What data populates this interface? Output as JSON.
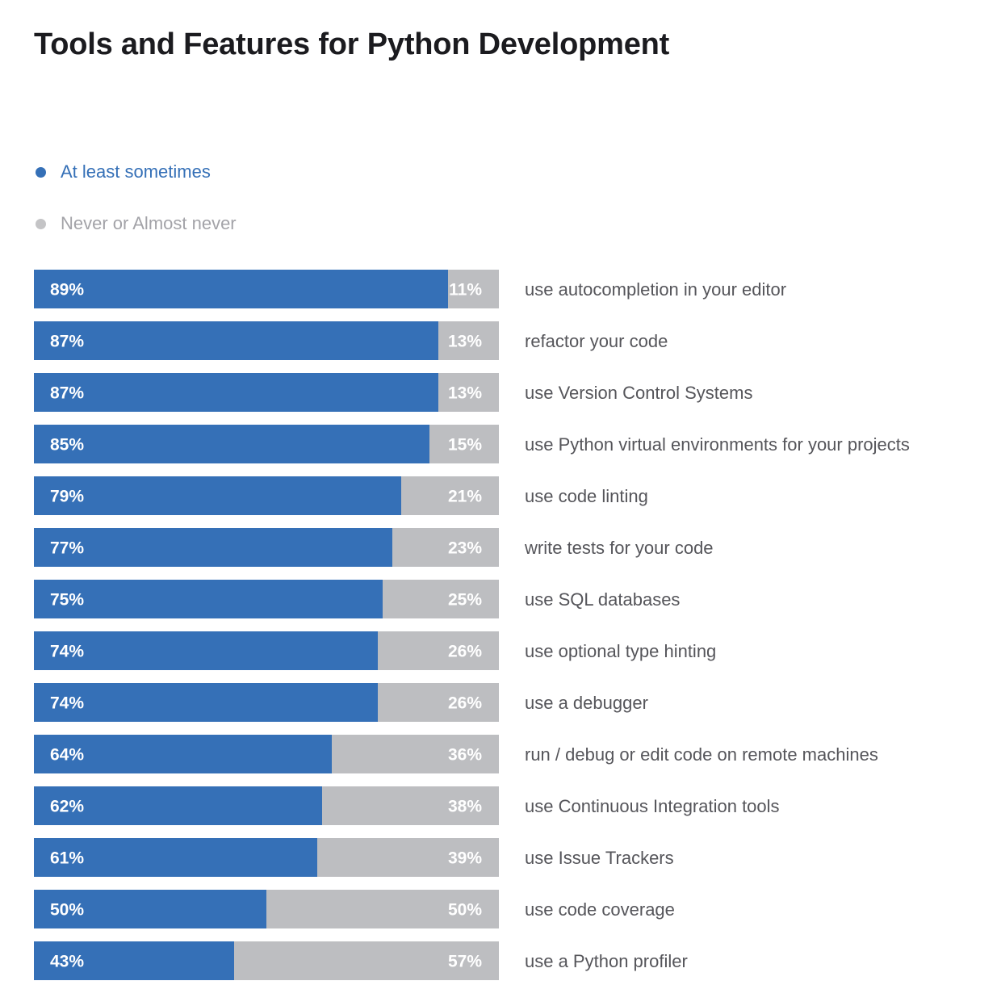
{
  "title": "Tools and Features for Python Development",
  "legend": [
    {
      "label": "At least sometimes",
      "color": "#3570b7",
      "text_color": "#3570b7"
    },
    {
      "label": "Never or Almost never",
      "color": "#c4c4c6",
      "text_color": "#a3a3a8"
    }
  ],
  "chart_data": {
    "type": "bar",
    "orientation": "horizontal",
    "stacked": true,
    "title": "Tools and Features for Python Development",
    "legend_position": "top-left",
    "xlim": [
      0,
      100
    ],
    "categories": [
      "use autocompletion in your editor",
      "refactor your code",
      "use Version Control Systems",
      "use Python virtual environments for your projects",
      "use code linting",
      "write tests for your code",
      "use SQL databases",
      "use optional type hinting",
      "use a debugger",
      "run / debug or edit code on remote machines",
      "use Continuous Integration tools",
      "use Issue Trackers",
      "use code coverage",
      "use a Python profiler"
    ],
    "series": [
      {
        "name": "At least sometimes",
        "color": "#3570b7",
        "values": [
          89,
          87,
          87,
          85,
          79,
          77,
          75,
          74,
          74,
          64,
          62,
          61,
          50,
          43
        ]
      },
      {
        "name": "Never or Almost never",
        "color": "#bdbec1",
        "values": [
          11,
          13,
          13,
          15,
          21,
          23,
          25,
          26,
          26,
          36,
          38,
          39,
          50,
          57
        ]
      }
    ],
    "value_suffix": "%",
    "grid": false
  }
}
